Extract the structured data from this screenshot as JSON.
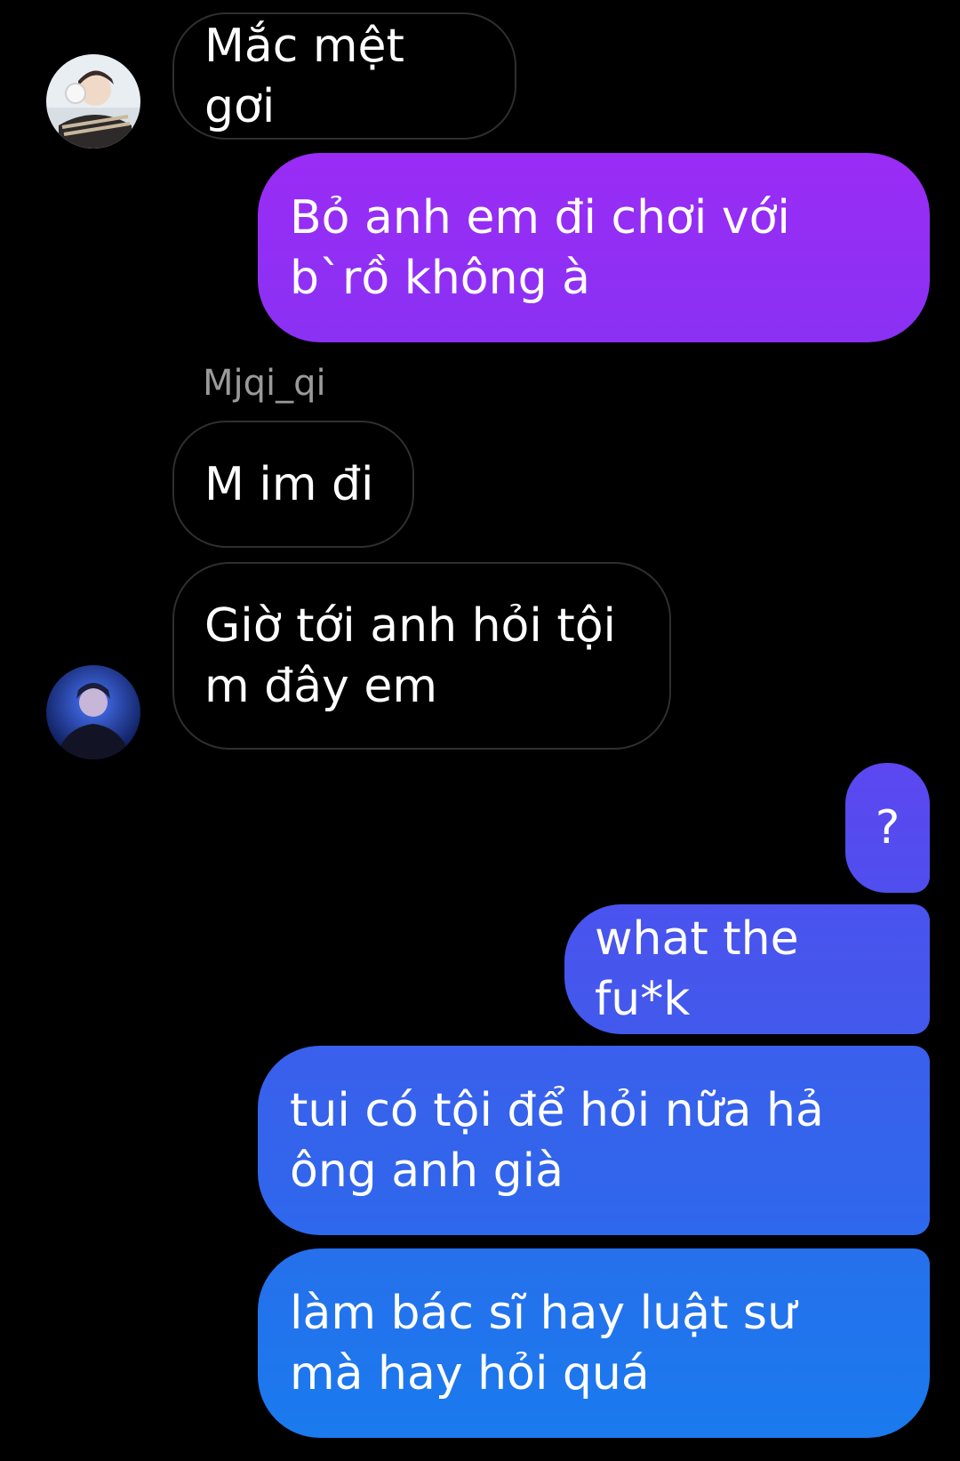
{
  "conversation": {
    "sender_name": "Mjqi_qi",
    "messages": [
      {
        "direction": "incoming",
        "text": "Mắc mệt gơi"
      },
      {
        "direction": "outgoing",
        "text": "Bỏ anh em đi chơi với b`rồ không à"
      },
      {
        "direction": "incoming",
        "text": "M im đi"
      },
      {
        "direction": "incoming",
        "text": "Giờ tới anh hỏi tội m đây em"
      },
      {
        "direction": "outgoing",
        "text": "?"
      },
      {
        "direction": "outgoing",
        "text": "what the fu*k"
      },
      {
        "direction": "outgoing",
        "text": "tui có tội để hỏi nữa hả ông anh già"
      },
      {
        "direction": "outgoing",
        "text": "làm bác sĩ hay luật sư mà hay hỏi quá"
      }
    ]
  },
  "avatars": [
    {
      "name": "contact-avatar-top",
      "icon": "avatar-earmuffs"
    },
    {
      "name": "contact-avatar-bottom",
      "icon": "avatar-blue-portrait"
    }
  ],
  "colors": {
    "background": "#000000",
    "incoming_border": "#2f2f2f",
    "outgoing_gradient": [
      "#9a2cf5",
      "#6a3ff0",
      "#3f58ea",
      "#1a7aee"
    ],
    "sender_name": "#9a9a9a"
  }
}
